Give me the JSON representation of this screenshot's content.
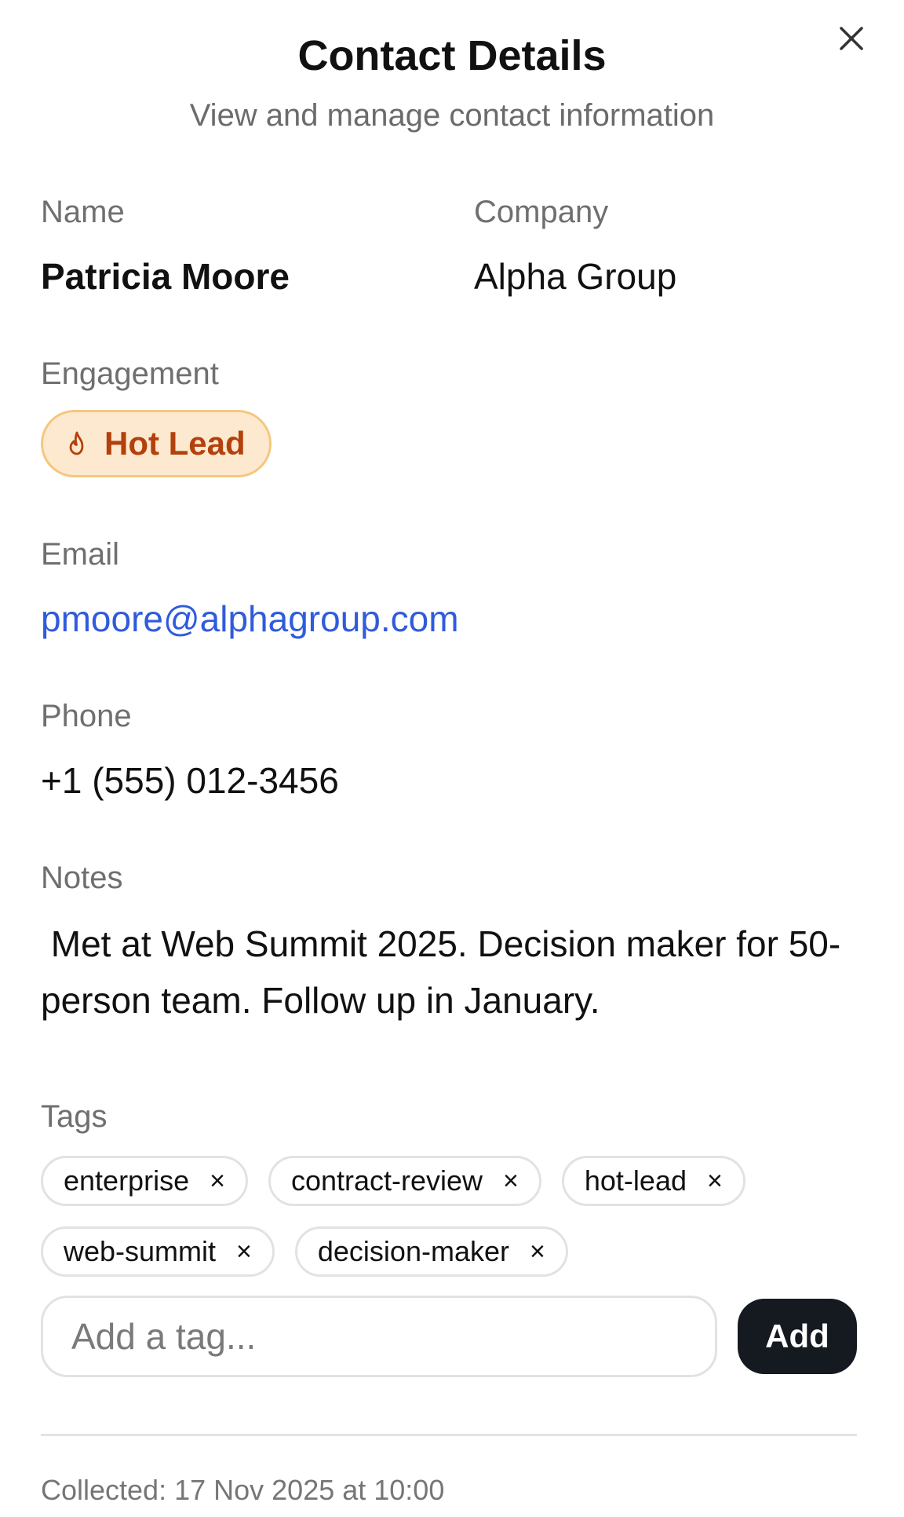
{
  "header": {
    "title": "Contact Details",
    "subtitle": "View and manage contact information"
  },
  "fields": {
    "name_label": "Name",
    "name_value": "Patricia Moore",
    "company_label": "Company",
    "company_value": "Alpha Group",
    "engagement_label": "Engagement",
    "engagement_value": "Hot Lead",
    "email_label": "Email",
    "email_value": "pmoore@alphagroup.com",
    "phone_label": "Phone",
    "phone_value": "+1 (555) 012-3456",
    "notes_label": "Notes",
    "notes_value": " Met at Web Summit 2025. Decision maker for 50-person team. Follow up in January."
  },
  "tags": {
    "label": "Tags",
    "items": [
      {
        "label": "enterprise",
        "remove": "×"
      },
      {
        "label": "contract-review",
        "remove": "×"
      },
      {
        "label": "hot-lead",
        "remove": "×"
      },
      {
        "label": "web-summit",
        "remove": "×"
      },
      {
        "label": "decision-maker",
        "remove": "×"
      }
    ],
    "input_placeholder": "Add a tag...",
    "add_label": "Add"
  },
  "footer": {
    "collected": "Collected: 17 Nov 2025 at 10:00"
  },
  "icons": {
    "close": "close-icon",
    "engagement": "flame-icon"
  },
  "colors": {
    "link": "#2f5bdc",
    "badge_bg": "#fde9cf",
    "badge_border": "#f5c77e",
    "badge_text": "#b3400d",
    "primary_button": "#151a21"
  }
}
